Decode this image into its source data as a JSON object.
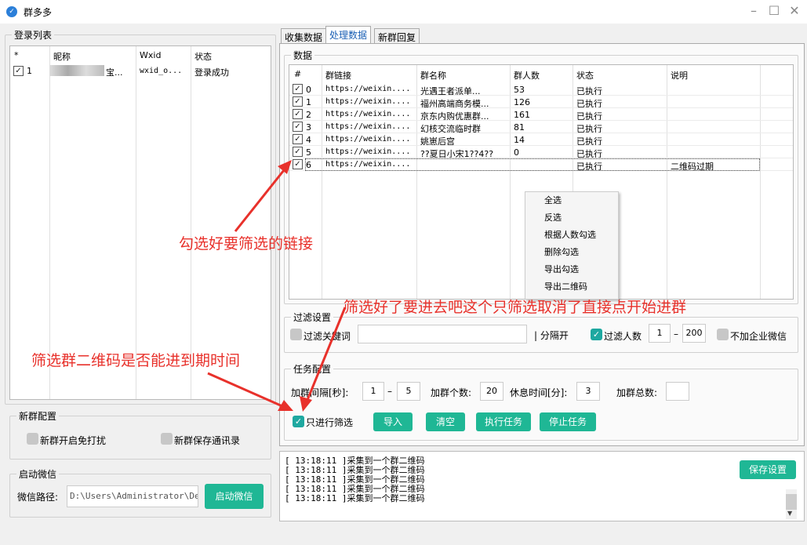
{
  "window": {
    "title": "群多多"
  },
  "login": {
    "legend": "登录列表",
    "headers": [
      "*",
      "昵称",
      "Wxid",
      "状态"
    ],
    "rows": [
      {
        "num": "1",
        "name": "宝...",
        "wxid": "wxid_o...",
        "status": "登录成功"
      }
    ]
  },
  "tabs": [
    "收集数据",
    "处理数据",
    "新群回复"
  ],
  "data": {
    "legend": "数据",
    "headers": [
      "#",
      "群链接",
      "群名称",
      "群人数",
      "状态",
      "说明"
    ],
    "rows": [
      {
        "num": "0",
        "link": "https://weixin....",
        "name": "光遇王者派单...",
        "count": "53",
        "status": "已执行",
        "note": ""
      },
      {
        "num": "1",
        "link": "https://weixin....",
        "name": "  福州高端商务模...",
        "count": "126",
        "status": "已执行",
        "note": ""
      },
      {
        "num": "2",
        "link": "https://weixin....",
        "name": "  京东内购优惠群...",
        "count": "161",
        "status": "已执行",
        "note": ""
      },
      {
        "num": "3",
        "link": "https://weixin....",
        "name": "幻核交流临时群",
        "count": "81",
        "status": "已执行",
        "note": ""
      },
      {
        "num": "4",
        "link": "https://weixin....",
        "name": "姚崽后宫",
        "count": "14",
        "status": "已执行",
        "note": ""
      },
      {
        "num": "5",
        "link": "https://weixin....",
        "name": "  ??夏日小宋1??4??",
        "count": "0",
        "status": "已执行",
        "note": ""
      },
      {
        "num": "6",
        "link": "https://weixin....",
        "name": "",
        "count": "",
        "status": "已执行",
        "note": "二维码过期"
      }
    ]
  },
  "context_menu": [
    "全选",
    "反选",
    "根据人数勾选",
    "删除勾选",
    "导出勾选",
    "导出二维码"
  ],
  "filter": {
    "legend": "过滤设置",
    "kw_label": "过滤关键词",
    "sep_label": "| 分隔开",
    "count_label": "过滤人数",
    "min": "1",
    "dash": "–",
    "max": "200",
    "nocorp_label": "不加企业微信"
  },
  "task": {
    "legend": "任务配置",
    "interval_label": "加群间隔[秒]:",
    "interval_min": "1",
    "interval_dash": "–",
    "interval_max": "5",
    "add_count_label": "加群个数:",
    "add_count": "20",
    "rest_label": "休息时间[分]:",
    "rest": "3",
    "total_label": "加群总数:",
    "total": "",
    "only_filter_label": "只进行筛选",
    "buttons": {
      "import": "导入",
      "clear": "清空",
      "run": "执行任务",
      "stop": "停止任务"
    }
  },
  "newgroup": {
    "legend": "新群配置",
    "dnd_label": "新群开启免打扰",
    "save_contacts_label": "新群保存通讯录"
  },
  "launch": {
    "legend": "启动微信",
    "path_label": "微信路径:",
    "path_value": "D:\\Users\\Administrator\\Deskt",
    "button": "启动微信"
  },
  "log": {
    "lines": [
      "[ 13:18:11 ]采集到一个群二维码",
      "[ 13:18:11 ]采集到一个群二维码",
      "[ 13:18:11 ]采集到一个群二维码",
      "[ 13:18:11 ]采集到一个群二维码",
      "[ 13:18:11 ]采集到一个群二维码"
    ],
    "save_button": "保存设置"
  },
  "annotations": {
    "a1": "勾选好要筛选的链接",
    "a2": "筛选好了要进去吧这个只筛选取消了直接点开始进群",
    "a3": "筛选群二维码是否能进到期时间"
  },
  "colors": {
    "accent": "#1fb795",
    "annotation": "#e8312b",
    "check_on": "#1ea8a0"
  }
}
